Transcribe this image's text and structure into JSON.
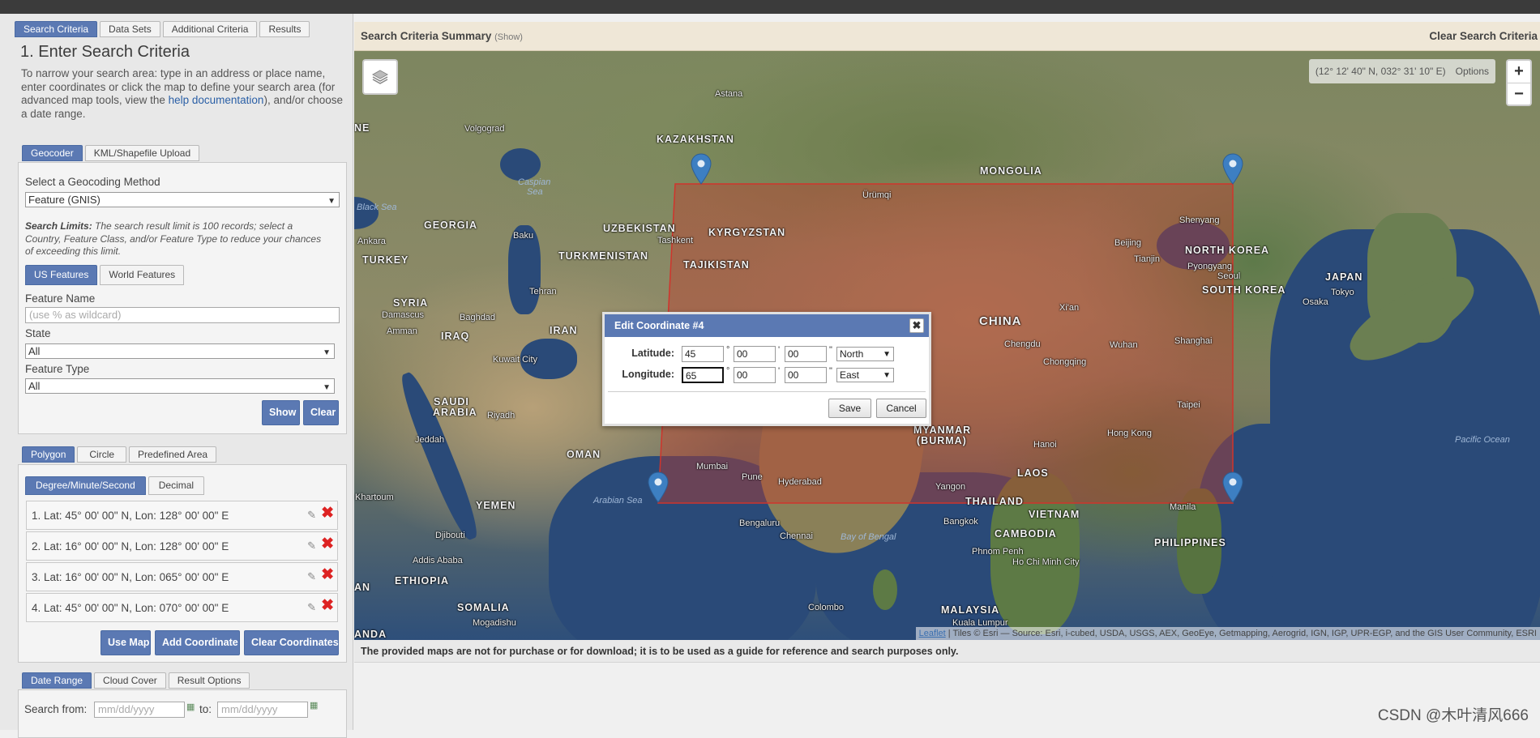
{
  "left_panel": {
    "main_tabs": [
      "Search Criteria",
      "Data Sets",
      "Additional Criteria",
      "Results"
    ],
    "step_title": "1. Enter Search Criteria",
    "intro_before_link": "To narrow your search area: type in an address or place name, enter coordinates or click the map to define your search area (for advanced map tools, view the ",
    "intro_link": "help documentation",
    "intro_after_link": "), and/or choose a date range.",
    "geo_tabs": [
      "Geocoder",
      "KML/Shapefile Upload"
    ],
    "geocoding_method_label": "Select a Geocoding Method",
    "geocoding_method_value": "Feature (GNIS)",
    "search_limits_bold": "Search Limits:",
    "search_limits_text": " The search result limit is 100 records; select a Country, Feature Class, and/or Feature Type to reduce your chances of exceeding this limit.",
    "feature_tabs": [
      "US Features",
      "World Features"
    ],
    "feature_name_label": "Feature Name",
    "feature_name_placeholder": "(use % as wildcard)",
    "state_label": "State",
    "state_value": "All",
    "feature_type_label": "Feature Type",
    "feature_type_value": "All",
    "show_button": "Show",
    "clear_button": "Clear",
    "area_tabs": [
      "Polygon",
      "Circle",
      "Predefined Area"
    ],
    "format_tabs": [
      "Degree/Minute/Second",
      "Decimal"
    ],
    "coordinates": [
      "1.  Lat: 45° 00' 00\" N, Lon: 128° 00' 00\" E",
      "2.  Lat: 16° 00' 00\" N, Lon: 128° 00' 00\" E",
      "3.  Lat: 16° 00' 00\" N, Lon: 065° 00' 00\" E",
      "4.  Lat: 45° 00' 00\" N, Lon: 070° 00' 00\" E"
    ],
    "use_map_button": "Use Map",
    "add_coordinate_button": "Add Coordinate",
    "clear_coordinates_button": "Clear Coordinates",
    "date_tabs": [
      "Date Range",
      "Cloud Cover",
      "Result Options"
    ],
    "search_from_label": "Search from:",
    "date_placeholder": "mm/dd/yyyy",
    "to_label": "to:"
  },
  "summary": {
    "title": "Search Criteria Summary",
    "show": "(Show)",
    "clear": "Clear Search Criteria"
  },
  "map": {
    "cursor_coords": "(12° 12' 40\" N, 032° 31' 10\" E)",
    "options": "Options",
    "zoom_in": "+",
    "zoom_out": "−",
    "attribution_link": "Leaflet",
    "attribution_text": " | Tiles © Esri — Source: Esri, i-cubed, USDA, USGS, AEX, GeoEye, Getmapping, Aerogrid, IGN, IGP, UPR-EGP, and the GIS User Community, ESRI",
    "polygon_fill": "#c0392b",
    "pin_color": "#3d7fc2",
    "labels": {
      "kazakhstan": "KAZAKHSTAN",
      "mongolia": "MONGOLIA",
      "china": "CHINA",
      "georgia": "GEORGIA",
      "uzbekistan": "UZBEKISTAN",
      "kyrgyzstan": "KYRGYZSTAN",
      "tajikistan": "TAJIKISTAN",
      "turkmenistan": "TURKMENISTAN",
      "turkey": "TURKEY",
      "syria": "SYRIA",
      "iraq": "IRAQ",
      "iran": "IRAN",
      "saudi": "SAUDI",
      "arabia": "ARABIA",
      "oman": "OMAN",
      "yemen": "YEMEN",
      "north_korea": "NORTH KOREA",
      "south_korea": "SOUTH KOREA",
      "japan": "JAPAN",
      "myanmar": "MYANMAR",
      "burma": "(BURMA)",
      "laos": "LAOS",
      "thailand": "THAILAND",
      "vietnam": "VIETNAM",
      "cambodia": "CAMBODIA",
      "philippines": "PHILIPPINES",
      "malaysia": "MALAYSIA",
      "ethiopia": "ETHIOPIA",
      "somalia": "SOMALIA",
      "ne": "NE",
      "an": "AN",
      "anda": "ANDA",
      "astana": "Astana",
      "volgograd": "Volgograd",
      "caspian": "Caspian",
      "sea": "Sea",
      "black_sea": "Black Sea",
      "baku": "Baku",
      "ankara": "Ankara",
      "tashkent": "Tashkent",
      "tehran": "Tehran",
      "damascus": "Damascus",
      "amman": "Amman",
      "baghdad": "Baghdad",
      "kuwait_city": "Kuwait City",
      "riyadh": "Riyadh",
      "jeddah": "Jeddah",
      "khartoum": "Khartoum",
      "djibouti": "Djibouti",
      "addis_ababa": "Addis Ababa",
      "mogadishu": "Mogadishu",
      "arabian_sea": "Arabian Sea",
      "mumbai": "Mumbai",
      "pune": "Pune",
      "hyderabad": "Hyderabad",
      "bengaluru": "Bengaluru",
      "chennai": "Chennai",
      "colombo": "Colombo",
      "bay_of_bengal": "Bay of Bengal",
      "yangon": "Yangon",
      "bangkok": "Bangkok",
      "phnom_penh": "Phnom Penh",
      "ho_chi_minh_city": "Ho Chi Minh City",
      "hanoi": "Hanoi",
      "hong_kong": "Hong Kong",
      "taipei": "Taipei",
      "manila": "Manila",
      "shanghai": "Shanghai",
      "wuhan": "Wuhan",
      "chongqing": "Chongqing",
      "chengdu": "Chengdu",
      "xian": "Xi'an",
      "beijing": "Beijing",
      "tianjin": "Tianjin",
      "shenyang": "Shenyang",
      "pyongyang": "Pyongyang",
      "seoul": "Seoul",
      "tokyo": "Tokyo",
      "osaka": "Osaka",
      "urumqi": "Ürümqi",
      "pacific_ocean": "Pacific Ocean",
      "kuala_lumpur": "Kuala Lumpur"
    }
  },
  "disclaimer": "The provided maps are not for purchase or for download; it is to be used as a guide for reference and search purposes only.",
  "watermark": "CSDN @木叶清风666",
  "dialog": {
    "title": "Edit Coordinate #4",
    "close": "✖",
    "latitude_label": "Latitude:",
    "lat_deg": "45",
    "lat_min": "00",
    "lat_sec": "00",
    "lat_dir": "North",
    "longitude_label": "Longitude:",
    "lon_deg": "65",
    "lon_min": "00",
    "lon_sec": "00",
    "lon_dir": "East",
    "deg_symbol": "°",
    "min_symbol": "'",
    "sec_symbol": "\"",
    "save": "Save",
    "cancel": "Cancel"
  }
}
